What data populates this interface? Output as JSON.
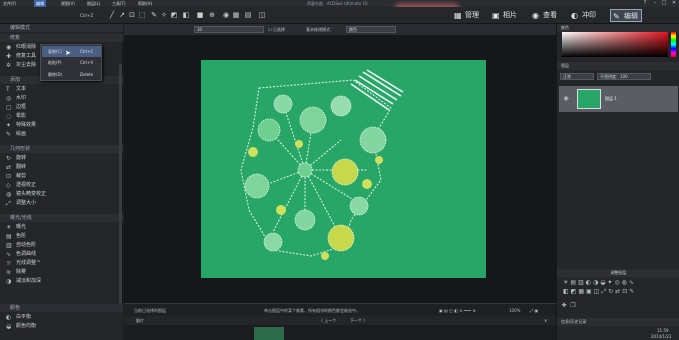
{
  "app_title": "荷瑟台起 · ACDSee Ultimate 10",
  "menu": [
    "文件(F)",
    "编辑",
    "视图(V)",
    "图层(L)",
    "工具(T)",
    "帮助(H)"
  ],
  "menu_shortcut": "Ctrl+Z",
  "window_controls": [
    "?",
    "–",
    "□",
    "✕"
  ],
  "modes": [
    {
      "label": "管理",
      "icon": "grid-icon",
      "glyph": "▦"
    },
    {
      "label": "相片",
      "icon": "photo-icon",
      "glyph": "▣"
    },
    {
      "label": "查看",
      "icon": "eye-icon",
      "glyph": "◉"
    },
    {
      "label": "冲印",
      "icon": "develop-icon",
      "glyph": "◐"
    },
    {
      "label": "编辑",
      "icon": "edit-icon",
      "glyph": "✎"
    }
  ],
  "context_menu": [
    {
      "label": "复制(C)",
      "shortcut": "Ctrl+C"
    },
    {
      "label": "粘贴(P)",
      "shortcut": "Ctrl+V"
    },
    {
      "label": "删除(D)",
      "shortcut": "Delete"
    }
  ],
  "left_panel": {
    "title": "编辑模式",
    "sections": [
      {
        "title": "修复",
        "items": [
          "红眼消除",
          "修复工具",
          "灰尘去除"
        ]
      },
      {
        "title": "添加",
        "items": [
          "文本",
          "水印",
          "边框",
          "晕影",
          "特殊效果",
          "绘画"
        ]
      },
      {
        "title": "几何形状",
        "items": [
          "旋转",
          "翻转",
          "裁剪",
          "透视校正",
          "镜头畸变校正",
          "调整大小"
        ]
      },
      {
        "title": "曝光/光线",
        "items": [
          "曝光",
          "色阶",
          "自动色阶",
          "色调曲线",
          "光线调整™",
          "除雾",
          "减淡和加深"
        ]
      },
      {
        "title": "颜色",
        "items": [
          "白平衡",
          "颜色均衡"
        ]
      }
    ]
  },
  "options_bar": {
    "size_value": "30",
    "checkbox_label": "已选择",
    "mode_label": "基本修改模式：",
    "mode_value": "颜色"
  },
  "status_bar": {
    "left": "当前已选择的图层",
    "center": "单击图层中的某个像素，所有相邻的颜色都会被选中。",
    "zoom": "100%"
  },
  "filmstrip": {
    "label": "胶片",
    "prev": "上一个",
    "next": "下一个"
  },
  "right_panel": {
    "color_title": "颜色",
    "layers_title": "图层",
    "blend_mode": "正常",
    "opacity": "不透明度：100",
    "layer_name": "图层 1",
    "adjust_title": "调整图层",
    "bottom_title": "信息/历史记录",
    "time": "11:59",
    "date": "2014/1/22"
  }
}
